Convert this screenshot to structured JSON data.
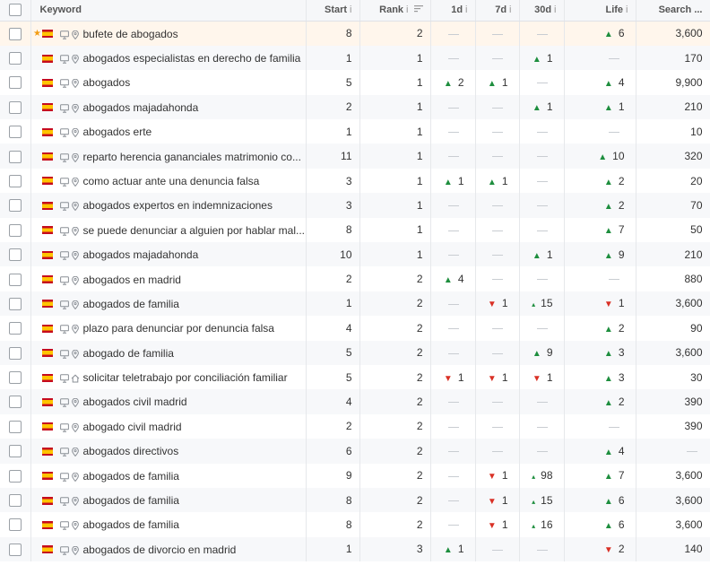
{
  "columns": {
    "keyword": "Keyword",
    "start": "Start",
    "rank": "Rank",
    "d1": "1d",
    "d7": "7d",
    "d30": "30d",
    "life": "Life",
    "search": "Search ..."
  },
  "icons": {
    "info": "i",
    "sort": "sort-icon",
    "star": "★"
  },
  "rows": [
    {
      "kw": "bufete de abogados",
      "start": "8",
      "rank": "2",
      "d1": "",
      "d1d": "",
      "d7": "",
      "d7d": "",
      "d30": "",
      "d30d": "",
      "life": "6",
      "lifed": "up",
      "search": "3,600",
      "star": true,
      "hl": true
    },
    {
      "kw": "abogados especialistas en derecho de familia",
      "start": "1",
      "rank": "1",
      "d1": "",
      "d1d": "",
      "d7": "",
      "d7d": "",
      "d30": "1",
      "d30d": "up",
      "life": "",
      "lifed": "",
      "search": "170"
    },
    {
      "kw": "abogados",
      "start": "5",
      "rank": "1",
      "d1": "2",
      "d1d": "up",
      "d7": "1",
      "d7d": "up",
      "d30": "",
      "d30d": "",
      "life": "4",
      "lifed": "up",
      "search": "9,900"
    },
    {
      "kw": "abogados majadahonda",
      "start": "2",
      "rank": "1",
      "d1": "",
      "d1d": "",
      "d7": "",
      "d7d": "",
      "d30": "1",
      "d30d": "up",
      "life": "1",
      "lifed": "up",
      "search": "210"
    },
    {
      "kw": "abogados erte",
      "start": "1",
      "rank": "1",
      "d1": "",
      "d1d": "",
      "d7": "",
      "d7d": "",
      "d30": "",
      "d30d": "",
      "life": "",
      "lifed": "",
      "search": "10"
    },
    {
      "kw": "reparto herencia gananciales matrimonio co...",
      "start": "11",
      "rank": "1",
      "d1": "",
      "d1d": "",
      "d7": "",
      "d7d": "",
      "d30": "",
      "d30d": "",
      "life": "10",
      "lifed": "up",
      "search": "320"
    },
    {
      "kw": "como actuar ante una denuncia falsa",
      "start": "3",
      "rank": "1",
      "d1": "1",
      "d1d": "up",
      "d7": "1",
      "d7d": "up",
      "d30": "",
      "d30d": "",
      "life": "2",
      "lifed": "up",
      "search": "20"
    },
    {
      "kw": "abogados expertos en indemnizaciones",
      "start": "3",
      "rank": "1",
      "d1": "",
      "d1d": "",
      "d7": "",
      "d7d": "",
      "d30": "",
      "d30d": "",
      "life": "2",
      "lifed": "up",
      "search": "70"
    },
    {
      "kw": "se puede denunciar a alguien por hablar mal...",
      "start": "8",
      "rank": "1",
      "d1": "",
      "d1d": "",
      "d7": "",
      "d7d": "",
      "d30": "",
      "d30d": "",
      "life": "7",
      "lifed": "up",
      "search": "50"
    },
    {
      "kw": "abogados majadahonda",
      "start": "10",
      "rank": "1",
      "d1": "",
      "d1d": "",
      "d7": "",
      "d7d": "",
      "d30": "1",
      "d30d": "up",
      "life": "9",
      "lifed": "up",
      "search": "210"
    },
    {
      "kw": "abogados en madrid",
      "start": "2",
      "rank": "2",
      "d1": "4",
      "d1d": "up",
      "d7": "",
      "d7d": "",
      "d30": "",
      "d30d": "",
      "life": "",
      "lifed": "",
      "search": "880"
    },
    {
      "kw": "abogados de familia",
      "start": "1",
      "rank": "2",
      "d1": "",
      "d1d": "",
      "d7": "1",
      "d7d": "down",
      "d30": "15",
      "d30d": "small",
      "life": "1",
      "lifed": "down",
      "search": "3,600"
    },
    {
      "kw": "plazo para denunciar por denuncia falsa",
      "start": "4",
      "rank": "2",
      "d1": "",
      "d1d": "",
      "d7": "",
      "d7d": "",
      "d30": "",
      "d30d": "",
      "life": "2",
      "lifed": "up",
      "search": "90"
    },
    {
      "kw": "abogado de familia",
      "start": "5",
      "rank": "2",
      "d1": "",
      "d1d": "",
      "d7": "",
      "d7d": "",
      "d30": "9",
      "d30d": "up",
      "life": "3",
      "lifed": "up",
      "search": "3,600"
    },
    {
      "kw": "solicitar teletrabajo por conciliación familiar",
      "start": "5",
      "rank": "2",
      "d1": "1",
      "d1d": "down",
      "d7": "1",
      "d7d": "down",
      "d30": "1",
      "d30d": "down",
      "life": "3",
      "lifed": "up",
      "search": "30",
      "home": true
    },
    {
      "kw": "abogados civil madrid",
      "start": "4",
      "rank": "2",
      "d1": "",
      "d1d": "",
      "d7": "",
      "d7d": "",
      "d30": "",
      "d30d": "",
      "life": "2",
      "lifed": "up",
      "search": "390"
    },
    {
      "kw": "abogado civil madrid",
      "start": "2",
      "rank": "2",
      "d1": "",
      "d1d": "",
      "d7": "",
      "d7d": "",
      "d30": "",
      "d30d": "",
      "life": "",
      "lifed": "",
      "search": "390"
    },
    {
      "kw": "abogados directivos",
      "start": "6",
      "rank": "2",
      "d1": "",
      "d1d": "",
      "d7": "",
      "d7d": "",
      "d30": "",
      "d30d": "",
      "life": "4",
      "lifed": "up",
      "search": ""
    },
    {
      "kw": "abogados de familia",
      "start": "9",
      "rank": "2",
      "d1": "",
      "d1d": "",
      "d7": "1",
      "d7d": "down",
      "d30": "98",
      "d30d": "small",
      "life": "7",
      "lifed": "up",
      "search": "3,600"
    },
    {
      "kw": "abogados de familia",
      "start": "8",
      "rank": "2",
      "d1": "",
      "d1d": "",
      "d7": "1",
      "d7d": "down",
      "d30": "15",
      "d30d": "small",
      "life": "6",
      "lifed": "up",
      "search": "3,600"
    },
    {
      "kw": "abogados de familia",
      "start": "8",
      "rank": "2",
      "d1": "",
      "d1d": "",
      "d7": "1",
      "d7d": "down",
      "d30": "16",
      "d30d": "small",
      "life": "6",
      "lifed": "up",
      "search": "3,600"
    },
    {
      "kw": "abogados de divorcio en madrid",
      "start": "1",
      "rank": "3",
      "d1": "1",
      "d1d": "up",
      "d7": "",
      "d7d": "",
      "d30": "",
      "d30d": "",
      "life": "2",
      "lifed": "down",
      "search": "140"
    }
  ]
}
